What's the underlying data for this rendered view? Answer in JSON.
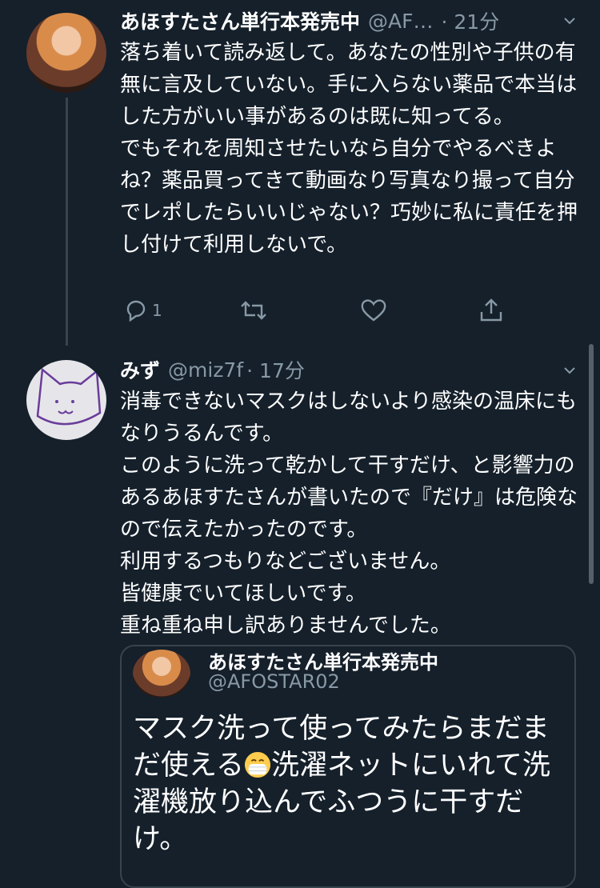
{
  "tweet1": {
    "name": "あほすたさん単行本発売中",
    "handle": "@AF…",
    "time": "· 21分",
    "text": "落ち着いて読み返して。あなたの性別や子供の有無に言及していない。手に入らない薬品で本当はした方がいい事があるのは既に知ってる。\nでもそれを周知させたいなら自分でやるべきよね？薬品買ってきて動画なり写真なり撮って自分でレポしたらいいじゃない？巧妙に私に責任を押し付けて利用しないで。",
    "reply_count": "1",
    "icons": [
      "reply-icon",
      "retweet-icon",
      "like-icon",
      "share-icon"
    ]
  },
  "tweet2": {
    "name": "みず",
    "handle": "@miz7f",
    "time": "· 17分",
    "text": "消毒できないマスクはしないより感染の温床にもなりうるんです。\nこのように洗って乾かして干すだけ、と影響力のあるあほすたさんが書いたので『だけ』は危険なので伝えたかったのです。\n利用するつもりなどございません。\n皆健康でいてほしいです。\n重ね重ね申し訳ありませんでした。"
  },
  "quote": {
    "name": "あほすたさん単行本発売中",
    "handle": "@AFOSTAR02",
    "text_before_emoji": "マスク洗って使ってみたらまだまだ使える",
    "emoji": "mask-face-emoji",
    "text_after_emoji": "洗濯ネットにいれて洗濯機放り込んでふつうに干すだけ。"
  },
  "colors": {
    "background": "#15202b",
    "text": "#ffffff",
    "secondary": "#8899a6",
    "border": "#38444d"
  }
}
